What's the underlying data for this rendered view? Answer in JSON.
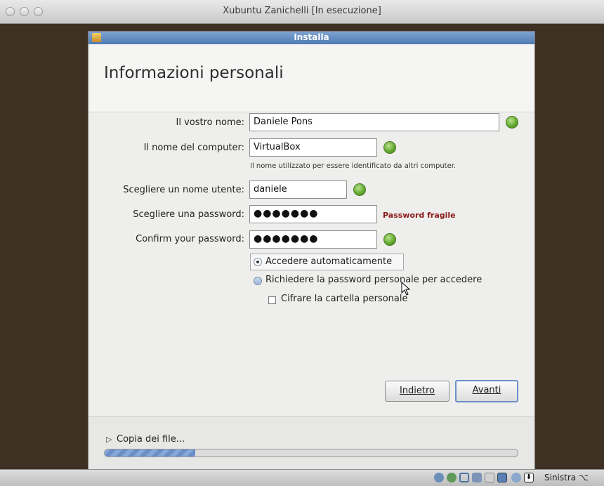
{
  "window": {
    "title": "Xubuntu Zanichelli [In esecuzione]"
  },
  "installer": {
    "title": "Installa",
    "page_title": "Informazioni personali",
    "fields": {
      "name_label": "Il vostro nome:",
      "name_value": "Daniele Pons",
      "computer_label": "Il nome del computer:",
      "computer_value": "VirtualBox",
      "computer_hint": "Il nome utilizzato per essere identificato da altri computer.",
      "username_label": "Scegliere un nome utente:",
      "username_value": "daniele",
      "password_label": "Scegliere una password:",
      "password_value": "●●●●●●●",
      "password_strength": "Password fragile",
      "confirm_label": "Confirm your password:",
      "confirm_value": "●●●●●●●"
    },
    "options": {
      "auto_login": "Accedere automaticamente",
      "require_password": "Richiedere la password personale per accedere",
      "encrypt_home": "Cifrare la cartella personale"
    },
    "buttons": {
      "back": "Indietro",
      "forward": "Avanti"
    },
    "progress": {
      "label": "Copia dei file...",
      "fraction": 0.22
    }
  },
  "statusbar": {
    "host_key": "Sinistra ⌥"
  },
  "colors": {
    "ok": "#5ea52c",
    "weak_password": "#8a1a1a",
    "title_bar": "#5f88bf"
  }
}
